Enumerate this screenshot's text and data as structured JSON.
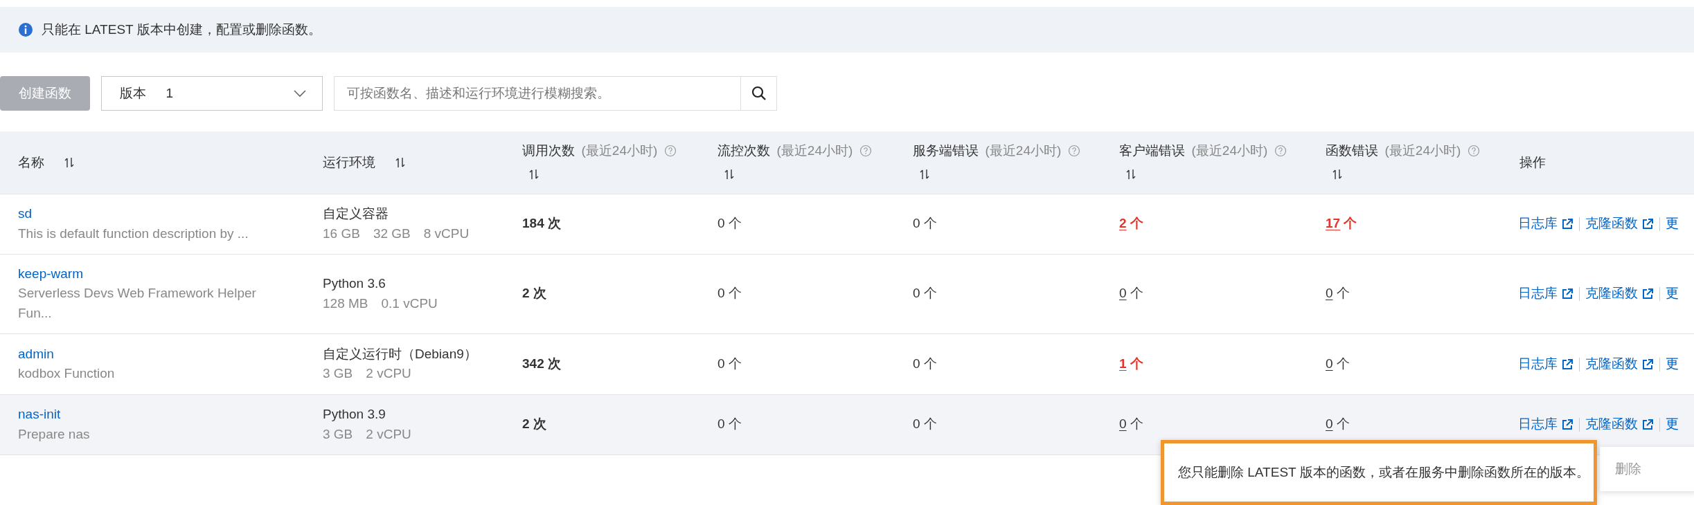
{
  "notice": {
    "text": "只能在 LATEST 版本中创建，配置或删除函数。"
  },
  "toolbar": {
    "create_button": {
      "label": "创建函数",
      "disabled": true
    },
    "version_select": {
      "label": "版本",
      "value": "1"
    },
    "search": {
      "placeholder": "可按函数名、描述和运行环境进行模糊搜索。"
    }
  },
  "table": {
    "columns": [
      {
        "label": "名称",
        "sortable": true,
        "help": false
      },
      {
        "label": "运行环境",
        "sortable": true,
        "help": false
      },
      {
        "label": "调用次数",
        "hint": "(最近24小时)",
        "sortable": true,
        "help": true
      },
      {
        "label": "流控次数",
        "hint": "(最近24小时)",
        "sortable": true,
        "help": true
      },
      {
        "label": "服务端错误",
        "hint": "(最近24小时)",
        "sortable": true,
        "help": true
      },
      {
        "label": "客户端错误",
        "hint": "(最近24小时)",
        "sortable": true,
        "help": true
      },
      {
        "label": "函数错误",
        "hint": "(最近24小时)",
        "sortable": true,
        "help": true
      },
      {
        "label": "操作",
        "sortable": false,
        "help": false
      }
    ],
    "rows": [
      {
        "name": "sd",
        "description": "This is default function description by ...",
        "runtime": "自定义容器",
        "specs": [
          "16 GB",
          "32 GB",
          "8 vCPU"
        ],
        "calls": "184 次",
        "throttles": "0 个",
        "server_errors": {
          "count": "0",
          "unit": "个",
          "link": false,
          "alert": false
        },
        "client_errors": {
          "count": "2",
          "unit": "个",
          "link": true,
          "alert": true
        },
        "function_errors": {
          "count": "17",
          "unit": "个",
          "link": true,
          "alert": true
        },
        "actions": [
          "日志库",
          "克隆函数",
          "更"
        ],
        "highlighted": false
      },
      {
        "name": "keep-warm",
        "description": "Serverless Devs Web Framework Helper Fun...",
        "runtime": "Python 3.6",
        "specs": [
          "128 MB",
          "0.1 vCPU"
        ],
        "calls": "2 次",
        "throttles": "0 个",
        "server_errors": {
          "count": "0",
          "unit": "个",
          "link": false,
          "alert": false
        },
        "client_errors": {
          "count": "0",
          "unit": "个",
          "link": true,
          "alert": false
        },
        "function_errors": {
          "count": "0",
          "unit": "个",
          "link": true,
          "alert": false
        },
        "actions": [
          "日志库",
          "克隆函数",
          "更"
        ],
        "highlighted": false
      },
      {
        "name": "admin",
        "description": "kodbox Function",
        "runtime": "自定义运行时（Debian9）",
        "specs": [
          "3 GB",
          "2 vCPU"
        ],
        "calls": "342 次",
        "throttles": "0 个",
        "server_errors": {
          "count": "0",
          "unit": "个",
          "link": false,
          "alert": false
        },
        "client_errors": {
          "count": "1",
          "unit": "个",
          "link": true,
          "alert": true
        },
        "function_errors": {
          "count": "0",
          "unit": "个",
          "link": true,
          "alert": false
        },
        "actions": [
          "日志库",
          "克隆函数",
          "更"
        ],
        "highlighted": false
      },
      {
        "name": "nas-init",
        "description": "Prepare nas",
        "runtime": "Python 3.9",
        "specs": [
          "3 GB",
          "2 vCPU"
        ],
        "calls": "2 次",
        "throttles": "0 个",
        "server_errors": {
          "count": "0",
          "unit": "个",
          "link": false,
          "alert": false
        },
        "client_errors": {
          "count": "0",
          "unit": "个",
          "link": true,
          "alert": false
        },
        "function_errors": {
          "count": "0",
          "unit": "个",
          "link": true,
          "alert": false
        },
        "actions": [
          "日志库",
          "克隆函数",
          "更"
        ],
        "highlighted": true
      }
    ]
  },
  "tooltip": {
    "text": "您只能删除 LATEST 版本的函数，或者在服务中删除函数所在的版本。",
    "outlined": true
  },
  "more_menu": {
    "items": [
      {
        "label": "删除",
        "disabled": true
      }
    ]
  }
}
